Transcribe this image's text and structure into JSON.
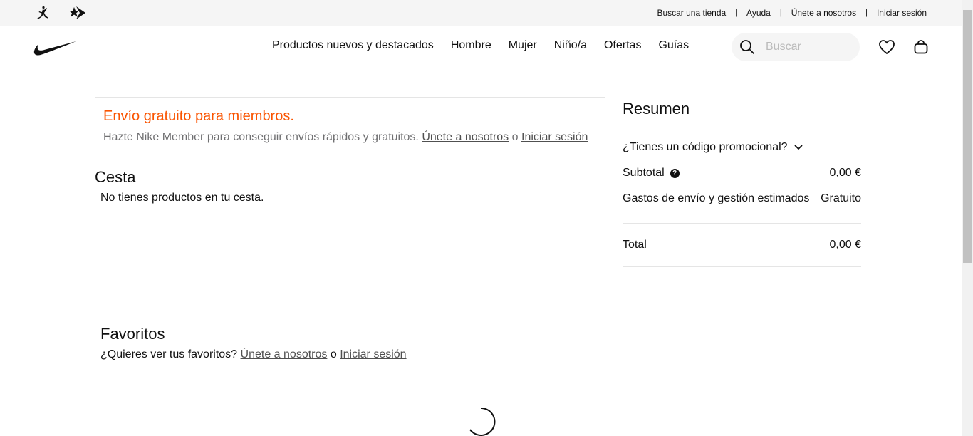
{
  "utility_bar": {
    "links": [
      "Buscar una tienda",
      "Ayuda",
      "Únete a nosotros",
      "Iniciar sesión"
    ],
    "separator": "|"
  },
  "nav": {
    "menu": [
      "Productos nuevos y destacados",
      "Hombre",
      "Mujer",
      "Niño/a",
      "Ofertas",
      "Guías"
    ],
    "search_placeholder": "Buscar"
  },
  "promo": {
    "title": "Envío gratuito para miembros.",
    "text": "Hazte Nike Member para conseguir envíos rápidos y gratuitos.",
    "join_link": "Únete a nosotros",
    "or": "o",
    "login_link": "Iniciar sesión"
  },
  "bag": {
    "heading": "Cesta",
    "empty_message": "No tienes productos en tu cesta."
  },
  "summary": {
    "title": "Resumen",
    "promo_code_label": "¿Tienes un código promocional?",
    "subtotal_label": "Subtotal",
    "subtotal_value": "0,00 €",
    "shipping_label": "Gastos de envío y gestión estimados",
    "shipping_value": "Gratuito",
    "total_label": "Total",
    "total_value": "0,00 €"
  },
  "favorites": {
    "heading": "Favoritos",
    "question": "¿Quieres ver tus favoritos?",
    "join_link": "Únete a nosotros",
    "or": "o",
    "login_link": "Iniciar sesión"
  },
  "icons": {
    "jordan": "jordan-logo-icon",
    "converse": "converse-logo-icon",
    "nike": "nike-swoosh-icon",
    "search": "search-icon",
    "favorites": "heart-icon",
    "bag": "bag-icon",
    "help": "question-circle-icon",
    "chevron": "chevron-down-icon",
    "loading": "spinner-icon"
  },
  "colors": {
    "promo_title": "#fa5400",
    "muted_text": "#707072",
    "util_bg": "#f5f5f5"
  }
}
